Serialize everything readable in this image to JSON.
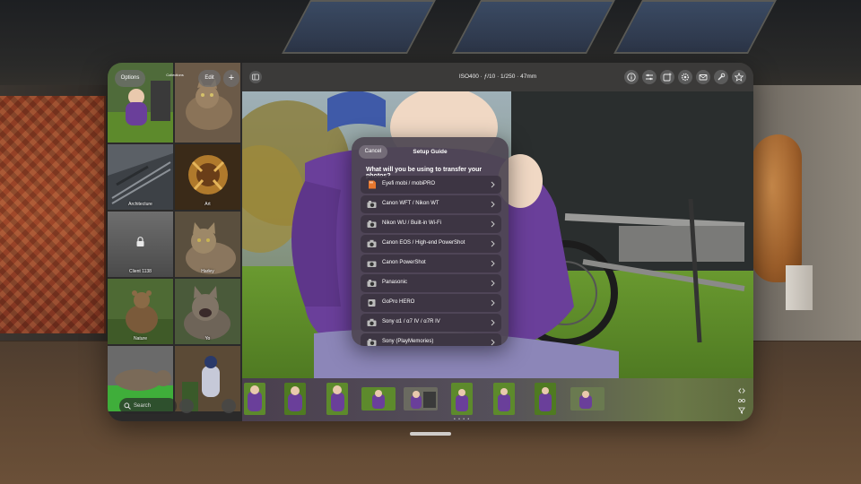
{
  "sidebar": {
    "options_label": "Options",
    "edit_label": "Edit",
    "add_label": "+",
    "title": "Collections",
    "subtitle": "",
    "albums": [
      {
        "label": "",
        "icon": "photo"
      },
      {
        "label": "",
        "icon": "photo"
      },
      {
        "label": "Architecture",
        "icon": "photo"
      },
      {
        "label": "Art",
        "icon": "photo"
      },
      {
        "label": "Client 1138",
        "icon": "lock-icon"
      },
      {
        "label": "Harley",
        "icon": "photo"
      },
      {
        "label": "Nature",
        "icon": "photo"
      },
      {
        "label": "Yo",
        "icon": "photo"
      },
      {
        "label": "",
        "icon": "photo"
      },
      {
        "label": "",
        "icon": "photo"
      }
    ],
    "search_placeholder": "Search"
  },
  "toolbar": {
    "exif": "ISO400  ·  ƒ/10  ·  1/250  ·  47mm",
    "icons": [
      "info-icon",
      "sliders-icon",
      "add-photo-icon",
      "gear-icon",
      "mail-icon",
      "wrench-icon",
      "star-icon"
    ]
  },
  "modal": {
    "cancel_label": "Cancel",
    "title": "Setup Guide",
    "question": "What will you be using to transfer your photos?",
    "options": [
      {
        "label": "Eyefi mobi / mobiPRO",
        "icon": "sd-card-icon"
      },
      {
        "label": "Canon WFT / Nikon WT",
        "icon": "camera-icon"
      },
      {
        "label": "Nikon WU / Built-in Wi-Fi",
        "icon": "camera-icon"
      },
      {
        "label": "Canon EOS / High-end PowerShot",
        "icon": "camera-icon"
      },
      {
        "label": "Canon PowerShot",
        "icon": "camera-icon"
      },
      {
        "label": "Panasonic",
        "icon": "camera-icon"
      },
      {
        "label": "GoPro HERO",
        "icon": "action-camera-icon"
      },
      {
        "label": "Sony α1 / α7 IV / α7R IV",
        "icon": "camera-icon"
      },
      {
        "label": "Sony (PlayMemories)",
        "icon": "camera-icon"
      }
    ]
  },
  "filmstrip": {
    "page_indicator": "• • • •",
    "thumb_count": 9
  },
  "colors": {
    "modal_bg": "#4e4652",
    "row_bg": "#3a3240",
    "grass": "#5f8a2e",
    "jacket": "#6a3f9a"
  }
}
